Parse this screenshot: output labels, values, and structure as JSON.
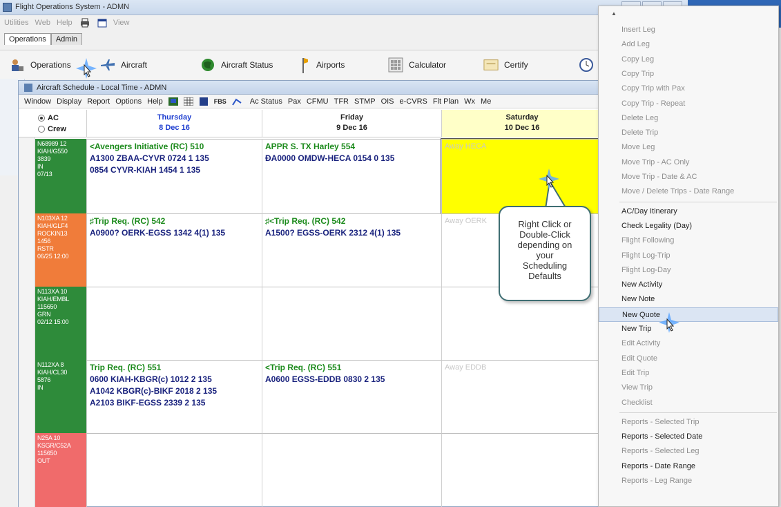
{
  "app": {
    "title": "Flight Operations System - ADMN",
    "menu": [
      "Utilities",
      "Web",
      "Help"
    ],
    "view_label": "View",
    "tabs": [
      "Operations",
      "Admin"
    ],
    "toolbar": [
      "Operations",
      "Aircraft",
      "Aircraft Status",
      "Airports",
      "Calculator",
      "Certify"
    ]
  },
  "schedule": {
    "title": "Aircraft Schedule - Local Time - ADMN",
    "menu": [
      "Window",
      "Display",
      "Report",
      "Options",
      "Help"
    ],
    "menu_right": [
      "Ac Status",
      "Pax",
      "CFMU",
      "TFR",
      "STMP",
      "OIS",
      "e-CVRS",
      "Flt Plan",
      "Wx",
      "Me"
    ],
    "fbs_label": "FBS",
    "radio": {
      "ac": "AC",
      "crew": "Crew"
    },
    "days": [
      {
        "name": "Thursday",
        "date": "8 Dec 16"
      },
      {
        "name": "Friday",
        "date": "9 Dec 16"
      },
      {
        "name": "Saturday",
        "date": "10 Dec 16"
      }
    ],
    "rows": [
      {
        "label": [
          "N68989 12",
          "KIAH/G550",
          "3839",
          "IN",
          "07/13"
        ],
        "color": "#2e8b3a",
        "thu": {
          "title": "<Avengers Initiative (RC) 510",
          "lines": [
            "A1300 ZBAA-CYVR 0724 1 135",
            "0854 CYVR-KIAH 1454 1 135"
          ]
        },
        "fri": {
          "title": "APPR S. TX Harley 554",
          "lines": [
            "ÐA0000 OMDW-HECA 0154 0 135"
          ]
        },
        "sat": {
          "away": "Away HECA"
        }
      },
      {
        "label": [
          "N103XA 12",
          "KIAH/GLF4",
          "ROCKIN13",
          "1456",
          "RSTR",
          "06/25 12:00"
        ],
        "color": "#f07c3a",
        "thu": {
          "title": "♯Trip Req. (RC) 542",
          "lines": [
            "A0900? OERK-EGSS 1342 4(1) 135"
          ]
        },
        "fri": {
          "title": "♯<Trip Req. (RC) 542",
          "lines": [
            "A1500? EGSS-OERK 2312 4(1) 135"
          ]
        },
        "sat": {
          "away": "Away OERK"
        }
      },
      {
        "label": [
          "N113XA 10",
          "KIAH/EMBL",
          "115650",
          "GRN",
          "02/12 15:00"
        ],
        "color": "#2e8b3a",
        "thu": {
          "title": "",
          "lines": []
        },
        "fri": {
          "title": "",
          "lines": []
        },
        "sat": {
          "away": ""
        }
      },
      {
        "label": [
          "N112XA 8",
          "KIAH/CL30",
          "5876",
          "IN"
        ],
        "color": "#2e8b3a",
        "thu": {
          "title": "Trip Req. (RC) 551",
          "lines": [
            "0600 KIAH-KBGR(c) 1012 2 135",
            "A1042 KBGR(c)-BIKF 2018 2 135",
            "A2103 BIKF-EGSS 2339 2 135"
          ]
        },
        "fri": {
          "title": "<Trip Req. (RC) 551",
          "lines": [
            "A0600 EGSS-EDDB 0830 2 135"
          ]
        },
        "sat": {
          "away": "Away EDDB"
        }
      },
      {
        "label": [
          "N25A 10",
          "KSGR/C52A",
          "115650",
          "OUT"
        ],
        "color": "#f06b6b",
        "thu": {
          "title": "",
          "lines": []
        },
        "fri": {
          "title": "",
          "lines": []
        },
        "sat": {
          "away": ""
        }
      }
    ]
  },
  "callout": {
    "lines": [
      "Right Click or",
      "Double-Click",
      "depending on",
      "your",
      "Scheduling",
      "Defaults"
    ]
  },
  "context_menu": {
    "items": [
      {
        "label": "Insert Leg",
        "enabled": false
      },
      {
        "label": "Add Leg",
        "enabled": false
      },
      {
        "label": "Copy Leg",
        "enabled": false
      },
      {
        "label": "Copy Trip",
        "enabled": false
      },
      {
        "label": "Copy Trip with Pax",
        "enabled": false
      },
      {
        "label": "Copy Trip - Repeat",
        "enabled": false
      },
      {
        "label": "Delete Leg",
        "enabled": false
      },
      {
        "label": "Delete Trip",
        "enabled": false
      },
      {
        "label": "Move Leg",
        "enabled": false
      },
      {
        "label": "Move Trip - AC Only",
        "enabled": false
      },
      {
        "label": "Move Trip - Date & AC",
        "enabled": false
      },
      {
        "label": "Move / Delete Trips - Date Range",
        "enabled": false
      },
      {
        "separator": true
      },
      {
        "label": "AC/Day Itinerary",
        "enabled": true
      },
      {
        "label": "Check Legality (Day)",
        "enabled": true
      },
      {
        "label": "Flight Following",
        "enabled": false
      },
      {
        "label": "Flight Log-Trip",
        "enabled": false
      },
      {
        "label": "Flight Log-Day",
        "enabled": false
      },
      {
        "label": "New Activity",
        "enabled": true
      },
      {
        "label": "New Note",
        "enabled": true
      },
      {
        "label": "New Quote",
        "enabled": true,
        "highlighted": true
      },
      {
        "label": "New Trip",
        "enabled": true
      },
      {
        "label": "Edit Activity",
        "enabled": false
      },
      {
        "label": "Edit Quote",
        "enabled": false
      },
      {
        "label": "Edit Trip",
        "enabled": false
      },
      {
        "label": "View Trip",
        "enabled": false
      },
      {
        "label": "Checklist",
        "enabled": false
      },
      {
        "separator": true
      },
      {
        "label": "Reports - Selected Trip",
        "enabled": false
      },
      {
        "label": "Reports - Selected Date",
        "enabled": true
      },
      {
        "label": "Reports - Selected Leg",
        "enabled": false
      },
      {
        "label": "Reports - Date Range",
        "enabled": true
      },
      {
        "label": "Reports - Leg Range",
        "enabled": false
      }
    ]
  },
  "colors": {
    "saturday_highlight": "#ffff00",
    "saturday_header": "#ffffc8",
    "day_blue": "#1f3fd0",
    "trip_green": "#1b8a1b",
    "trip_navy": "#1a237e",
    "callout_border": "#3f6e73"
  }
}
